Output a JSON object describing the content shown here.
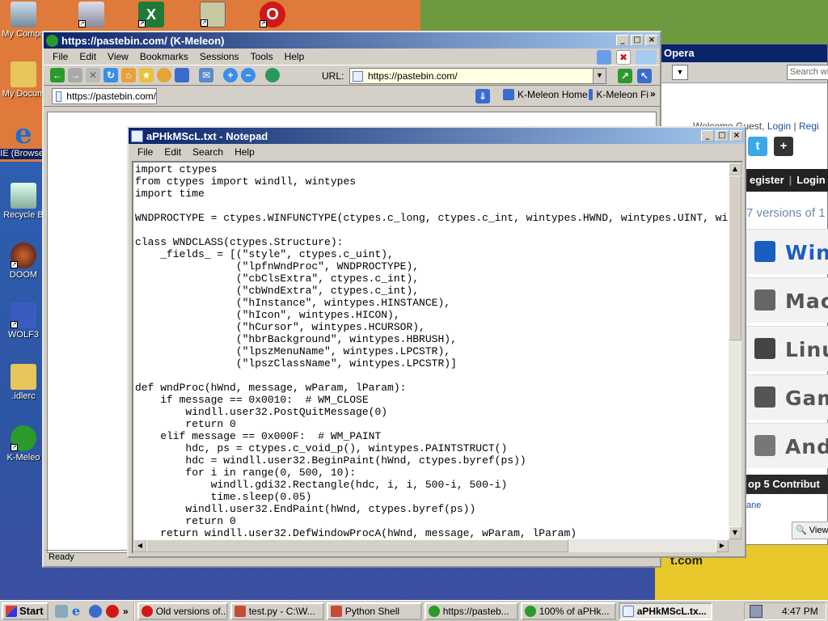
{
  "desktop": {
    "icons": [
      {
        "label": "My Compu",
        "icon": "my-computer-icon"
      },
      {
        "label": "My Docum",
        "icon": "my-documents-icon"
      },
      {
        "label": "IE (Browser",
        "icon": "internet-explorer-icon"
      },
      {
        "label": "Recycle B",
        "icon": "recycle-bin-icon"
      },
      {
        "label": "DOOM",
        "icon": "doom-icon"
      },
      {
        "label": "WOLF3",
        "icon": "wolf3d-icon"
      },
      {
        "label": ".idlerc",
        "icon": "folder-icon"
      },
      {
        "label": "K-Meleo",
        "icon": "k-meleon-icon"
      }
    ],
    "top_icons": [
      "network-printer-icon",
      "excel-icon",
      "image-viewer-icon",
      "opera-icon"
    ]
  },
  "opera": {
    "title": "Opera",
    "search_placeholder": "Search wi",
    "welcome": "Welcome Guest,",
    "login": "Login",
    "register_short": "Regi",
    "nav_register": "egister",
    "nav_login": "Login",
    "versions_text": "7 versions of 1",
    "os_rows": [
      "Win",
      "Mac",
      "Linu",
      "Gam",
      "Andr"
    ],
    "top_contributors": "op 5 Contribut",
    "contributor": "ane",
    "view_button": "View (",
    "site_suffix": "t.com"
  },
  "kmeleon": {
    "title": "https://pastebin.com/ (K-Meleon)",
    "menu": [
      "File",
      "Edit",
      "View",
      "Bookmarks",
      "Sessions",
      "Tools",
      "Help"
    ],
    "url_label": "URL:",
    "url": "https://pastebin.com/",
    "tab_label": "https://pastebin.com/",
    "bookmarks": [
      "K-Meleon Home",
      "K-Meleon Fi"
    ],
    "more": "»",
    "status": "Ready"
  },
  "notepad": {
    "title": "aPHkMScL.txt - Notepad",
    "menu": [
      "File",
      "Edit",
      "Search",
      "Help"
    ],
    "content": "import ctypes\nfrom ctypes import windll, wintypes\nimport time\n\nWNDPROCTYPE = ctypes.WINFUNCTYPE(ctypes.c_long, ctypes.c_int, wintypes.HWND, wintypes.UINT, wi\n\nclass WNDCLASS(ctypes.Structure):\n    _fields_ = [(\"style\", ctypes.c_uint),\n                (\"lpfnWndProc\", WNDPROCTYPE),\n                (\"cbClsExtra\", ctypes.c_int),\n                (\"cbWndExtra\", ctypes.c_int),\n                (\"hInstance\", wintypes.HINSTANCE),\n                (\"hIcon\", wintypes.HICON),\n                (\"hCursor\", wintypes.HCURSOR),\n                (\"hbrBackground\", wintypes.HBRUSH),\n                (\"lpszMenuName\", wintypes.LPCSTR),\n                (\"lpszClassName\", wintypes.LPCSTR)]\n\ndef wndProc(hWnd, message, wParam, lParam):\n    if message == 0x0010:  # WM_CLOSE\n        windll.user32.PostQuitMessage(0)\n        return 0\n    elif message == 0x000F:  # WM_PAINT\n        hdc, ps = ctypes.c_void_p(), wintypes.PAINTSTRUCT()\n        hdc = windll.user32.BeginPaint(hWnd, ctypes.byref(ps))\n        for i in range(0, 500, 10):\n            windll.gdi32.Rectangle(hdc, i, i, 500-i, 500-i)\n            time.sleep(0.05)\n        windll.user32.EndPaint(hWnd, ctypes.byref(ps))\n        return 0\n    return windll.user32.DefWindowProcA(hWnd, message, wParam, lParam)"
  },
  "taskbar": {
    "start": "Start",
    "quick_launch": [
      "show-desktop-icon",
      "ie-icon",
      "media-icon",
      "opera-icon"
    ],
    "more": "»",
    "tasks": [
      {
        "label": "Old versions of...",
        "icon": "opera-icon",
        "color": "#d01818"
      },
      {
        "label": "test.py - C:\\W...",
        "icon": "python-icon",
        "color": "#c84a3a"
      },
      {
        "label": "Python Shell",
        "icon": "python-icon",
        "color": "#c84a3a"
      },
      {
        "label": "https://pasteb...",
        "icon": "k-meleon-icon",
        "color": "#2a9a2a"
      },
      {
        "label": "100% of aPHk...",
        "icon": "k-meleon-icon",
        "color": "#2a9a2a"
      },
      {
        "label": "aPHkMScL.tx...",
        "icon": "notepad-icon",
        "color": "#5a8ac8",
        "active": true
      }
    ],
    "clock": "4:47 PM"
  },
  "colors": {
    "title_active": "#0a246a",
    "title_gradient_end": "#a6caf0",
    "url_bg": "#ffffe1",
    "wallpaper_orange": "#e07a3a",
    "wallpaper_green": "#6d9a3e",
    "wallpaper_blue": "#2f5fb0"
  }
}
